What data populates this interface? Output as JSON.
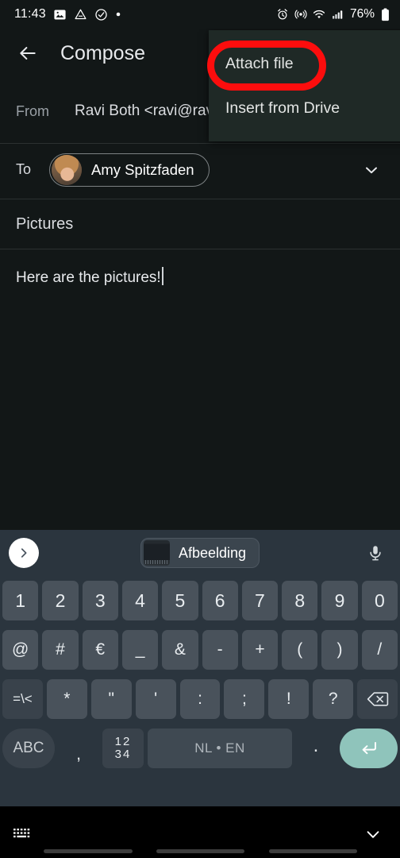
{
  "status_bar": {
    "time": "11:43",
    "left_icons": [
      "photos-icon",
      "drive-icon",
      "check-circle-icon",
      "dot-icon"
    ],
    "right_icons": [
      "alarm-icon",
      "hotspot-icon",
      "wifi-icon",
      "signal-icon"
    ],
    "battery_percent": "76%",
    "battery_icon": "battery-icon"
  },
  "app_bar": {
    "back_icon": "back-arrow-icon",
    "title": "Compose"
  },
  "overflow_menu": {
    "items": [
      {
        "label": "Attach file"
      },
      {
        "label": "Insert from Drive"
      }
    ],
    "highlight_color": "#fc0d0d",
    "highlighted_item": "Attach file"
  },
  "compose": {
    "from_label": "From",
    "from_value": "Ravi Both <ravi@rav",
    "to_label": "To",
    "recipient": {
      "name": "Amy Spitzfaden",
      "avatar": "contact-avatar"
    },
    "expand_icon": "chevron-down-icon",
    "subject": "Pictures",
    "body": "Here are the pictures!"
  },
  "keyboard": {
    "suggestion_bar": {
      "expand_icon": "chevron-right-icon",
      "clip_label": "Afbeelding",
      "clip_thumb": "image-thumbnail",
      "mic_icon": "microphone-icon"
    },
    "rows": [
      {
        "keys": [
          {
            "label": "1",
            "style": "key"
          },
          {
            "label": "2",
            "style": "key"
          },
          {
            "label": "3",
            "style": "key"
          },
          {
            "label": "4",
            "style": "key"
          },
          {
            "label": "5",
            "style": "key"
          },
          {
            "label": "6",
            "style": "key"
          },
          {
            "label": "7",
            "style": "key"
          },
          {
            "label": "8",
            "style": "key"
          },
          {
            "label": "9",
            "style": "key"
          },
          {
            "label": "0",
            "style": "key"
          }
        ]
      },
      {
        "keys": [
          {
            "label": "@",
            "style": "key sym"
          },
          {
            "label": "#",
            "style": "key sym"
          },
          {
            "label": "€",
            "style": "key sym"
          },
          {
            "label": "_",
            "style": "key sym"
          },
          {
            "label": "&",
            "style": "key sym"
          },
          {
            "label": "-",
            "style": "key sym"
          },
          {
            "label": "+",
            "style": "key sym"
          },
          {
            "label": "(",
            "style": "key sym"
          },
          {
            "label": ")",
            "style": "key sym"
          },
          {
            "label": "/",
            "style": "key sym"
          }
        ]
      },
      {
        "keys": [
          {
            "label": "=\\<",
            "style": "key fn small"
          },
          {
            "label": "*",
            "style": "key sym"
          },
          {
            "label": "\"",
            "style": "key sym"
          },
          {
            "label": "'",
            "style": "key sym"
          },
          {
            "label": ":",
            "style": "key sym"
          },
          {
            "label": ";",
            "style": "key sym"
          },
          {
            "label": "!",
            "style": "key sym"
          },
          {
            "label": "?",
            "style": "key sym"
          },
          {
            "label": "backspace-icon",
            "style": "key fn"
          }
        ]
      },
      {
        "keys": [
          {
            "label": "ABC",
            "style": "key abc"
          },
          {
            "label": ",",
            "style": "key punct-left"
          },
          {
            "label": "12 34",
            "style": "key numkey"
          },
          {
            "label": "NL • EN",
            "style": "key space"
          },
          {
            "label": ".",
            "style": "key punct-left"
          },
          {
            "label": "enter-icon",
            "style": "key enter"
          }
        ]
      }
    ],
    "num_key_top": "12",
    "num_key_bottom": "34",
    "enter_color": "#8fc4bb"
  },
  "nav_bar": {
    "keyboard_switch_icon": "keyboard-icon",
    "hide_keyboard_icon": "chevron-down-icon"
  }
}
